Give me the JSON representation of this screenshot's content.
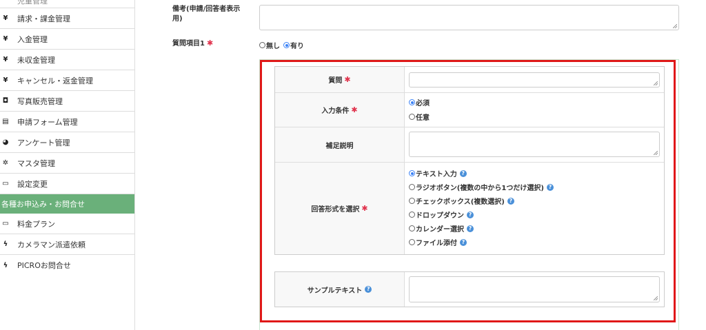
{
  "sidebar": {
    "top_partial": "児童管理",
    "items": [
      {
        "icon": "yen-icon",
        "glyph": "¥",
        "label": "請求・課金管理"
      },
      {
        "icon": "yen-icon",
        "glyph": "¥",
        "label": "入金管理"
      },
      {
        "icon": "yen-icon",
        "glyph": "¥",
        "label": "未収金管理"
      },
      {
        "icon": "yen-icon",
        "glyph": "¥",
        "label": "キャンセル・返金管理"
      },
      {
        "icon": "camera-icon",
        "glyph": "◘",
        "label": "写真販売管理"
      },
      {
        "icon": "document-icon",
        "glyph": "▤",
        "label": "申請フォーム管理"
      },
      {
        "icon": "chart-icon",
        "glyph": "◕",
        "label": "アンケート管理"
      },
      {
        "icon": "gear-icon",
        "glyph": "✲",
        "label": "マスタ管理"
      },
      {
        "icon": "monitor-icon",
        "glyph": "▭",
        "label": "設定変更"
      }
    ],
    "section_header": "各種お申込み・お問合せ",
    "items2": [
      {
        "icon": "monitor-icon",
        "glyph": "▭",
        "label": "料金プラン"
      },
      {
        "icon": "bolt-icon",
        "glyph": "ϟ",
        "label": "カメラマン派遣依頼"
      },
      {
        "icon": "bolt-icon",
        "glyph": "ϟ",
        "label": "PICROお問合せ"
      }
    ]
  },
  "form": {
    "remarks_label": "備考(申請/回答者表示用)",
    "question1_label": "質問項目1",
    "question1_options": {
      "none": "無し",
      "yes": "有り"
    },
    "question_label": "質問",
    "input_condition_label": "入力条件",
    "input_condition_options": {
      "required": "必須",
      "optional": "任意"
    },
    "supplement_label": "補足説明",
    "answer_format_label": "回答形式を選択",
    "answer_formats": [
      "テキスト入力",
      "ラジオボタン(複数の中から1つだけ選択)",
      "チェックボックス(複数選択)",
      "ドロップダウン",
      "カレンダー選択",
      "ファイル添付"
    ],
    "sample_text_label": "サンプルテキスト",
    "required_mark": "✱",
    "help_mark": "?"
  },
  "colors": {
    "accent": "#6ab07a",
    "highlight": "#e01818",
    "required": "#e0334d",
    "radio": "#3b82f6",
    "help": "#4a90d9"
  }
}
